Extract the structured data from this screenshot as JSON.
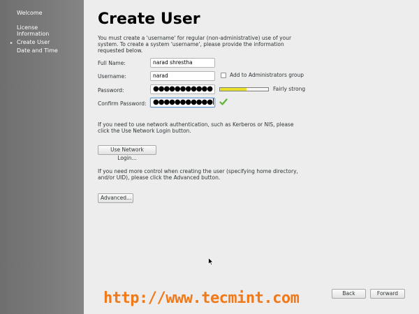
{
  "sidebar": {
    "items": [
      {
        "label": "Welcome",
        "current": false
      },
      {
        "label": "License\nInformation",
        "current": false
      },
      {
        "label": "Create User",
        "current": true
      },
      {
        "label": "Date and Time",
        "current": false
      }
    ],
    "current_marker": "▸"
  },
  "page": {
    "title": "Create User",
    "intro": "You must create a 'username' for regular (non-administrative) use of your system.  To create a system 'username', please provide the information requested below."
  },
  "form": {
    "full_name": {
      "label": "Full Name:",
      "value": "narad shrestha"
    },
    "username": {
      "label": "Username:",
      "value": "narad"
    },
    "password": {
      "label": "Password:",
      "masked": "●●●●●●●●●●●"
    },
    "confirm_password": {
      "label": "Confirm Password:",
      "masked": "●●●●●●●●●●●"
    },
    "admin_checkbox": {
      "label": "Add to Administrators group",
      "checked": false
    },
    "strength": {
      "label": "Fairly strong",
      "level": 0.55,
      "color": "#e7e227"
    }
  },
  "network": {
    "text": "If you need to use network authentication, such as Kerberos or NIS, please click the Use Network Login button.",
    "button": "Use Network Login..."
  },
  "advanced": {
    "text": "If you need more control when creating the user (specifying home directory, and/or UID), please click the Advanced button.",
    "button": "Advanced..."
  },
  "footer": {
    "back": "Back",
    "forward": "Forward"
  },
  "watermark": "http://www.tecmint.com",
  "icons": {
    "match": "checkmark-icon",
    "pointer": "mouse-pointer-icon"
  },
  "colors": {
    "sidebar": "#7a7a7a",
    "watermark": "#f07a1a",
    "check": "#5db532"
  }
}
